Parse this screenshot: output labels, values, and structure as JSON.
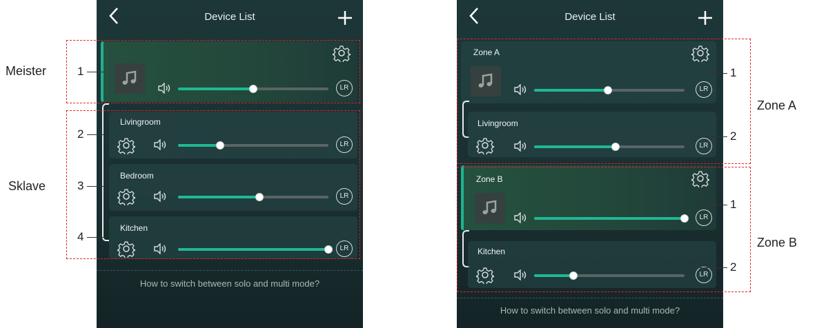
{
  "app": {
    "title": "Device List",
    "back_icon": "chevron-left-icon",
    "add_icon": "plus-icon",
    "hint": "How to switch between solo and multi mode?"
  },
  "left_screen": {
    "master_card": {
      "volume_pct": 50
    },
    "slave_cards": [
      {
        "name": "Livingroom",
        "volume_pct": 28
      },
      {
        "name": "Bedroom",
        "volume_pct": 54
      },
      {
        "name": "Kitchen",
        "volume_pct": 100
      }
    ]
  },
  "right_screen": {
    "zones": [
      {
        "master_name": "Zone A",
        "master_volume_pct": 49,
        "slave_name": "Livingroom",
        "slave_volume_pct": 54
      },
      {
        "master_name": "Zone B",
        "master_volume_pct": 100,
        "slave_name": "Kitchen",
        "slave_volume_pct": 26
      }
    ]
  },
  "channel_button": "LR",
  "annotations": {
    "left": {
      "master_label": "Meister",
      "slave_label": "Sklave",
      "n1": "1",
      "n2": "2",
      "n3": "3",
      "n4": "4"
    },
    "right": {
      "zone_a": "Zone A",
      "zone_b": "Zone B",
      "a1": "1",
      "a2": "2",
      "b1": "1",
      "b2": "2"
    }
  },
  "colors": {
    "accent": "#1fb893",
    "highlight_box": "#e0232b",
    "phone_bg": "#1d3637"
  }
}
